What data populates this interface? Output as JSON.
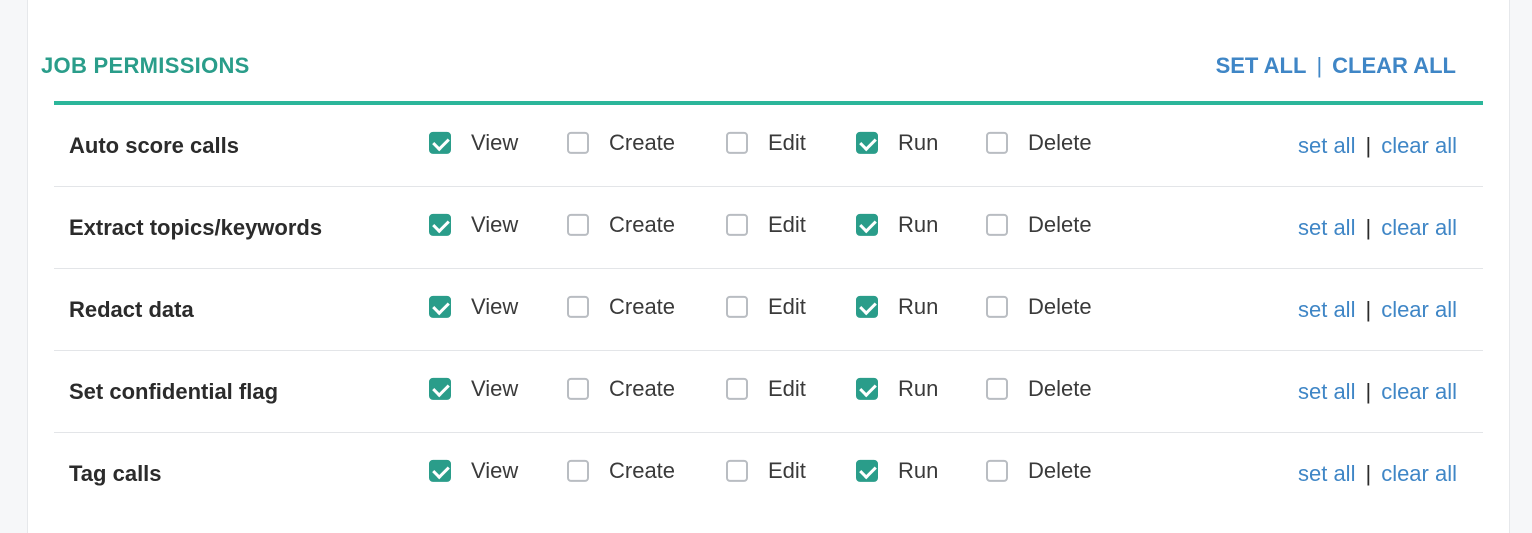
{
  "section": {
    "title": "JOB PERMISSIONS",
    "set_all": "SET ALL",
    "separator": "|",
    "clear_all": "CLEAR ALL"
  },
  "colors": {
    "accent": "#2bb69a",
    "title": "#2a9d8a",
    "link": "#3f86c6",
    "checkbox_checked": "#2a9d8a"
  },
  "row_actions": {
    "set_all": "set all",
    "separator": "|",
    "clear_all": "clear all"
  },
  "rows": [
    {
      "label": "Auto score calls",
      "perms": [
        {
          "label": "View",
          "checked": true
        },
        {
          "label": "Create",
          "checked": false
        },
        {
          "label": "Edit",
          "checked": false
        },
        {
          "label": "Run",
          "checked": true
        },
        {
          "label": "Delete",
          "checked": false
        }
      ]
    },
    {
      "label": "Extract topics/keywords",
      "perms": [
        {
          "label": "View",
          "checked": true
        },
        {
          "label": "Create",
          "checked": false
        },
        {
          "label": "Edit",
          "checked": false
        },
        {
          "label": "Run",
          "checked": true
        },
        {
          "label": "Delete",
          "checked": false
        }
      ]
    },
    {
      "label": "Redact data",
      "perms": [
        {
          "label": "View",
          "checked": true
        },
        {
          "label": "Create",
          "checked": false
        },
        {
          "label": "Edit",
          "checked": false
        },
        {
          "label": "Run",
          "checked": true
        },
        {
          "label": "Delete",
          "checked": false
        }
      ]
    },
    {
      "label": "Set confidential flag",
      "perms": [
        {
          "label": "View",
          "checked": true
        },
        {
          "label": "Create",
          "checked": false
        },
        {
          "label": "Edit",
          "checked": false
        },
        {
          "label": "Run",
          "checked": true
        },
        {
          "label": "Delete",
          "checked": false
        }
      ]
    },
    {
      "label": "Tag calls",
      "perms": [
        {
          "label": "View",
          "checked": true
        },
        {
          "label": "Create",
          "checked": false
        },
        {
          "label": "Edit",
          "checked": false
        },
        {
          "label": "Run",
          "checked": true
        },
        {
          "label": "Delete",
          "checked": false
        }
      ]
    }
  ]
}
